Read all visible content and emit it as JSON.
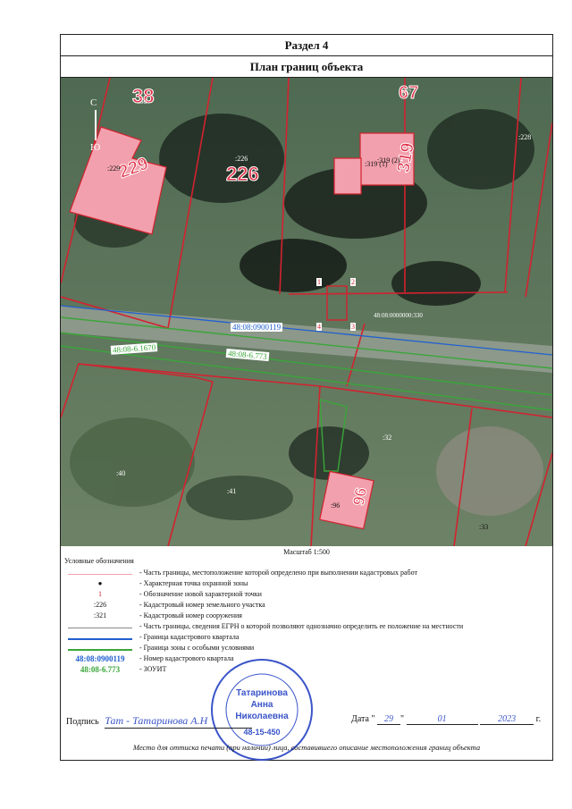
{
  "header": {
    "section": "Раздел 4",
    "title": "План границ объекта"
  },
  "map": {
    "north_label": "С",
    "south_label": "Ю",
    "parcels": [
      {
        "big": "38",
        "small": ":38"
      },
      {
        "big": "229",
        "small": ":229"
      },
      {
        "big": "226",
        "small": ":226"
      },
      {
        "big": "67",
        "small": ":67"
      },
      {
        "big": "319",
        "small": ":319 (1)"
      },
      {
        "big": "96",
        "small": ":96"
      }
    ],
    "labels": [
      ":228",
      ":319 (2)",
      ":32",
      ":40",
      ":41",
      ":33"
    ],
    "points": [
      "1",
      "2",
      "3",
      "4"
    ],
    "quarter": "48:08:0900119",
    "zone1": "48:08-6.1670",
    "zone2": "48:08-6.773",
    "edge_label": "48:08:0000000:330"
  },
  "scale": "Масштаб 1:500",
  "legend": {
    "title": "Условные обозначения",
    "items": [
      {
        "symbol": "",
        "text": "- Часть границы, местоположение которой определено при выполнении кадастровых работ"
      },
      {
        "symbol": "●",
        "text": "- Характерная точка охранной зоны"
      },
      {
        "symbol": "1",
        "text": "- Обозначение новой характерной точки"
      },
      {
        "symbol": ":226",
        "text": "- Кадастровый номер земельного участка"
      },
      {
        "symbol": ":321",
        "text": "- Кадастровый номер сооружения"
      },
      {
        "symbol": "",
        "text": "- Часть границы, сведения ЕГРН о которой позволяют однозначно определить ее положение на местности"
      },
      {
        "symbol": "",
        "text": "- Граница кадастрового квартала"
      },
      {
        "symbol": "",
        "text": "- Граница зоны с особыми условиями"
      },
      {
        "symbol": "48:08:0900119",
        "text": "- Номер кадастрового квартала"
      },
      {
        "symbol": "48:08-6.773",
        "text": "- ЗОУИТ"
      }
    ]
  },
  "signature": {
    "label": "Подпись",
    "handwriting": "Тат - Татаринова А.Н",
    "date_label": "Дата \"",
    "day": "29",
    "month": "01",
    "year": "2023",
    "year_suffix": "г."
  },
  "stamp": {
    "name1": "Татаринова",
    "name2": "Анна",
    "name3": "Николаевна",
    "reg": "48-15-450"
  },
  "footer": "Место для оттиска печати (при наличии) лица, составившего описание местоположения границ объекта",
  "colors": {
    "red_line": "#d3222f",
    "green_line": "#3aa63a",
    "blue_line": "#2060d0",
    "parcel_fill": "#f2a0ad"
  }
}
